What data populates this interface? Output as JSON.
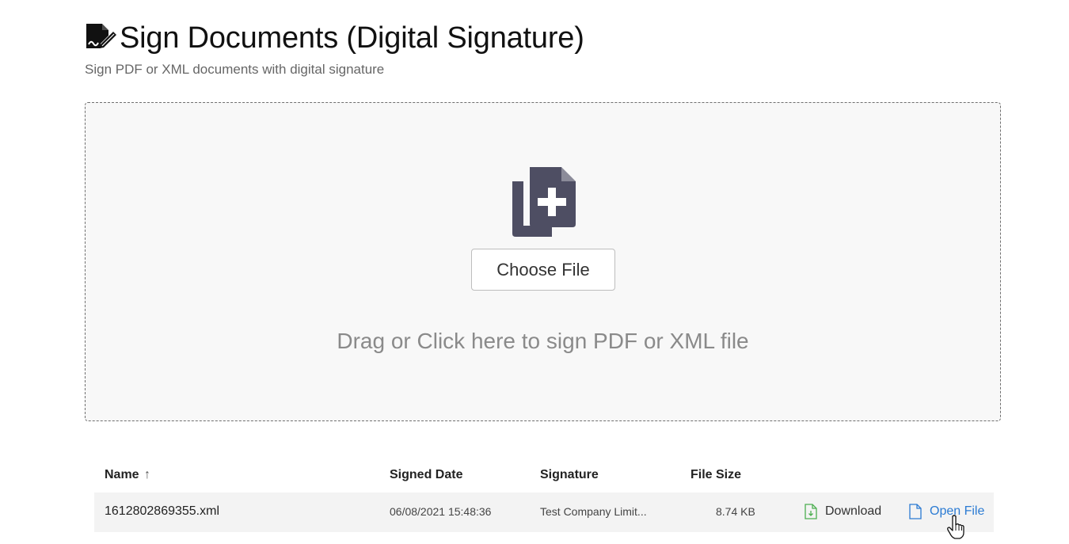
{
  "header": {
    "title": "Sign Documents (Digital Signature)",
    "subtitle": "Sign PDF or XML documents with digital signature",
    "icon": "signature-doc-icon"
  },
  "dropzone": {
    "button_label": "Choose File",
    "hint": "Drag or Click here to sign PDF or XML file",
    "icon": "file-add-icon"
  },
  "table": {
    "columns": {
      "name": "Name",
      "sort_indicator": "↑",
      "signed_date": "Signed Date",
      "signature": "Signature",
      "file_size": "File Size"
    },
    "rows": [
      {
        "name": "1612802869355.xml",
        "signed_date": "06/08/2021 15:48:36",
        "signature": "Test Company Limit...",
        "file_size": "8.74 KB",
        "download_label": "Download",
        "open_label": "Open File"
      }
    ]
  },
  "colors": {
    "accent": "#2b7bd3",
    "download_icon": "#4caf50",
    "icon_dark": "#4e4e63"
  }
}
